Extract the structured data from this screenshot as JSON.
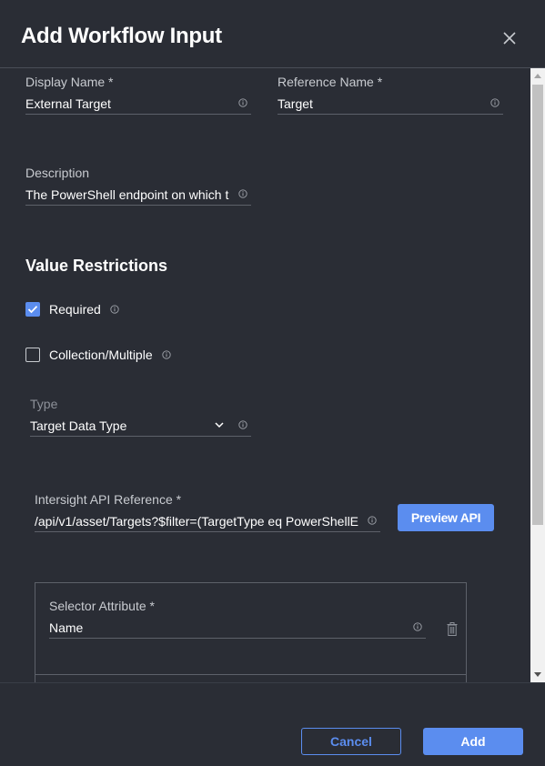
{
  "dialog": {
    "title": "Add Workflow Input"
  },
  "fields": {
    "display_name": {
      "label": "Display Name *",
      "value": "External Target"
    },
    "reference_name": {
      "label": "Reference Name *",
      "value": "Target"
    },
    "description": {
      "label": "Description",
      "value": "The PowerShell endpoint on which t"
    }
  },
  "value_restrictions": {
    "title": "Value Restrictions",
    "required": {
      "label": "Required",
      "checked": true
    },
    "collection": {
      "label": "Collection/Multiple",
      "checked": false
    }
  },
  "type_field": {
    "label": "Type",
    "value": "Target Data Type"
  },
  "api_reference": {
    "label": "Intersight API Reference *",
    "value": "/api/v1/asset/Targets?$filter=(TargetType eq PowerShellE",
    "preview_label": "Preview API"
  },
  "selector": {
    "label": "Selector Attribute *",
    "value": "Name"
  },
  "footer": {
    "cancel_label": "Cancel",
    "add_label": "Add"
  },
  "colors": {
    "background": "#2a2d35",
    "accent": "#5b8def",
    "divider": "#5d616a"
  },
  "icons": {
    "close": "close-icon",
    "info": "info-icon",
    "check": "checkmark-icon",
    "chevron": "chevron-down-icon",
    "trash": "trash-icon"
  }
}
